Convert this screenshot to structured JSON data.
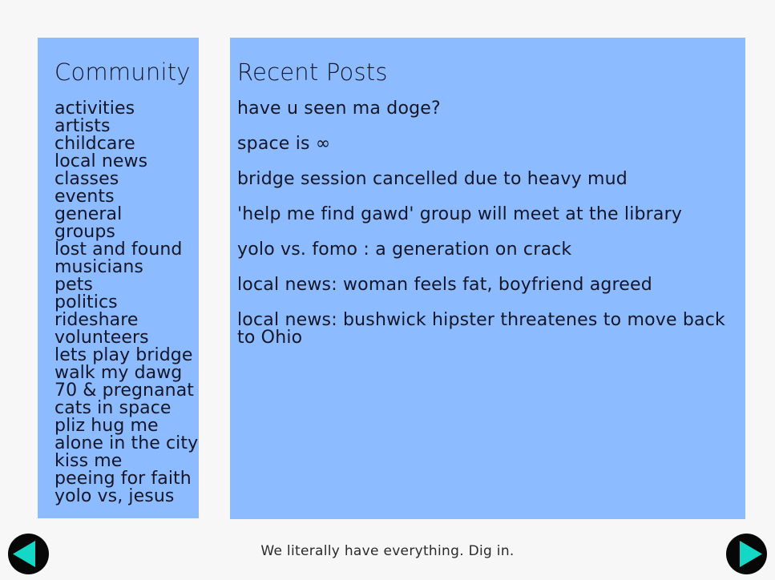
{
  "community": {
    "title": "Community",
    "categories": [
      "activities",
      "artists",
      "childcare",
      "local news",
      "classes",
      "events",
      "general",
      "groups",
      "lost and found",
      "musicians",
      "pets",
      "politics",
      "rideshare",
      "volunteers",
      "lets play bridge",
      "walk my dawg",
      "70 & pregnanat",
      "cats in space",
      "pliz hug me",
      "alone in the city",
      "kiss me",
      "peeing for faith",
      "yolo vs, jesus"
    ]
  },
  "recent_posts": {
    "title": "Recent Posts",
    "posts": [
      "have u seen ma doge?",
      "space is ∞",
      "bridge session cancelled due to heavy mud",
      "'help me find gawd' group will meet at the library",
      "yolo vs. fomo : a generation on crack",
      "local news: woman feels fat, boyfriend agreed",
      "local news: bushwick hipster threatenes to move back to Ohio"
    ]
  },
  "footer": {
    "tagline": "We literally have everything. Dig in."
  },
  "navigation": {
    "prev_icon": "left-arrow-icon",
    "next_icon": "right-arrow-icon",
    "button_color": "#070707",
    "arrow_color": "#13d8c6"
  },
  "colors": {
    "panel_background": "#8cbcff",
    "page_background": "#f7f7f7",
    "text": "#151528"
  }
}
